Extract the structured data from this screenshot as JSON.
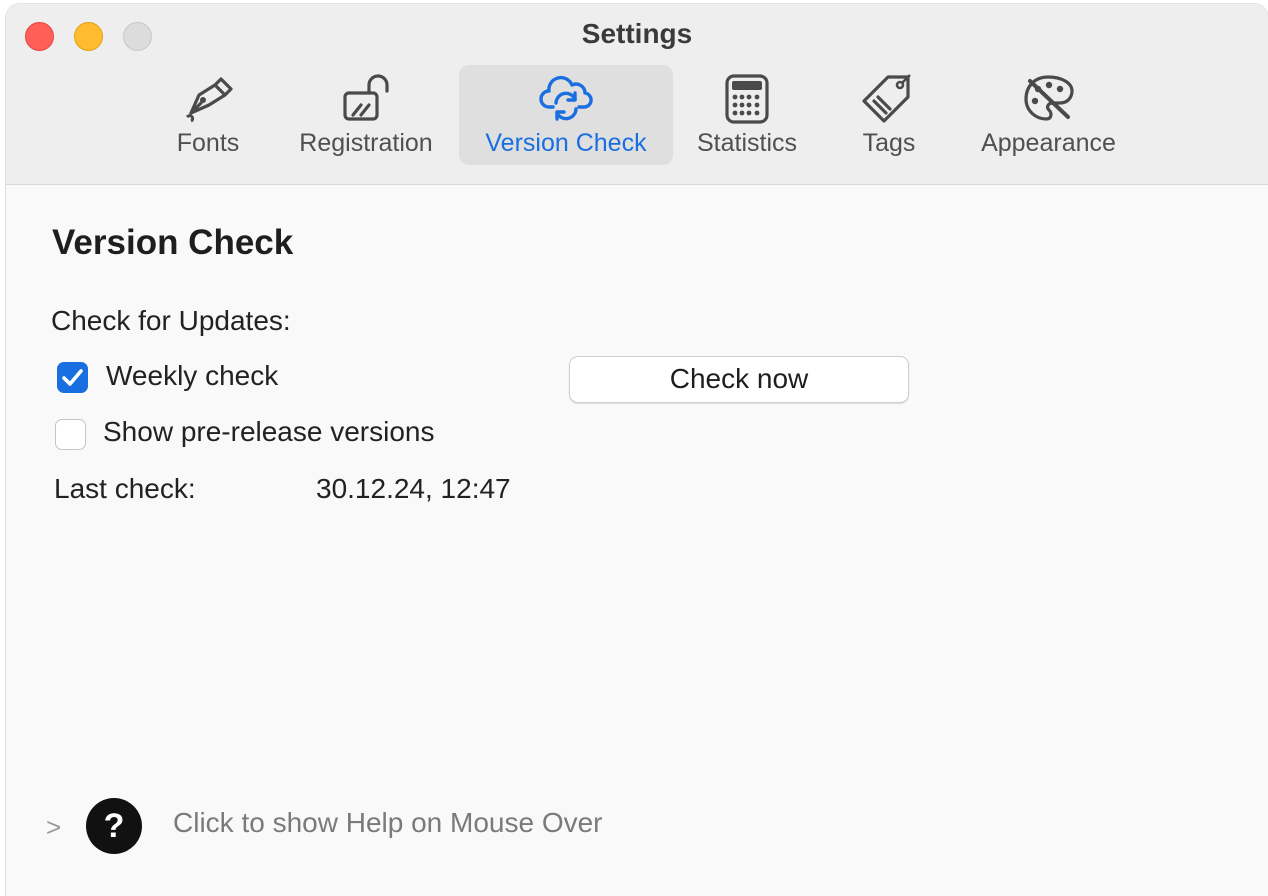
{
  "window": {
    "title": "Settings"
  },
  "toolbar": {
    "tabs": [
      {
        "label": "Fonts",
        "icon": "pen-nib-icon"
      },
      {
        "label": "Registration",
        "icon": "unlocked-padlock-icon"
      },
      {
        "label": "Version Check",
        "icon": "cloud-sync-icon",
        "active": true
      },
      {
        "label": "Statistics",
        "icon": "calculator-icon"
      },
      {
        "label": "Tags",
        "icon": "tag-icon"
      },
      {
        "label": "Appearance",
        "icon": "palette-icon"
      }
    ]
  },
  "content": {
    "title": "Version Check",
    "updates_label": "Check for Updates:",
    "weekly_check": {
      "label": "Weekly check",
      "checked": true
    },
    "prerelease": {
      "label": "Show pre-release versions",
      "checked": false
    },
    "check_now_label": "Check now",
    "last_check_label": "Last check:",
    "last_check_value": "30.12.24, 12:47"
  },
  "help": {
    "text": "Click to show Help on Mouse Over",
    "chevron": ">",
    "icon_glyph": "?"
  },
  "colors": {
    "accent": "#1a6fe0",
    "close": "#ff5f57",
    "minimize": "#febc2e",
    "zoom": "#dcdcdc"
  }
}
